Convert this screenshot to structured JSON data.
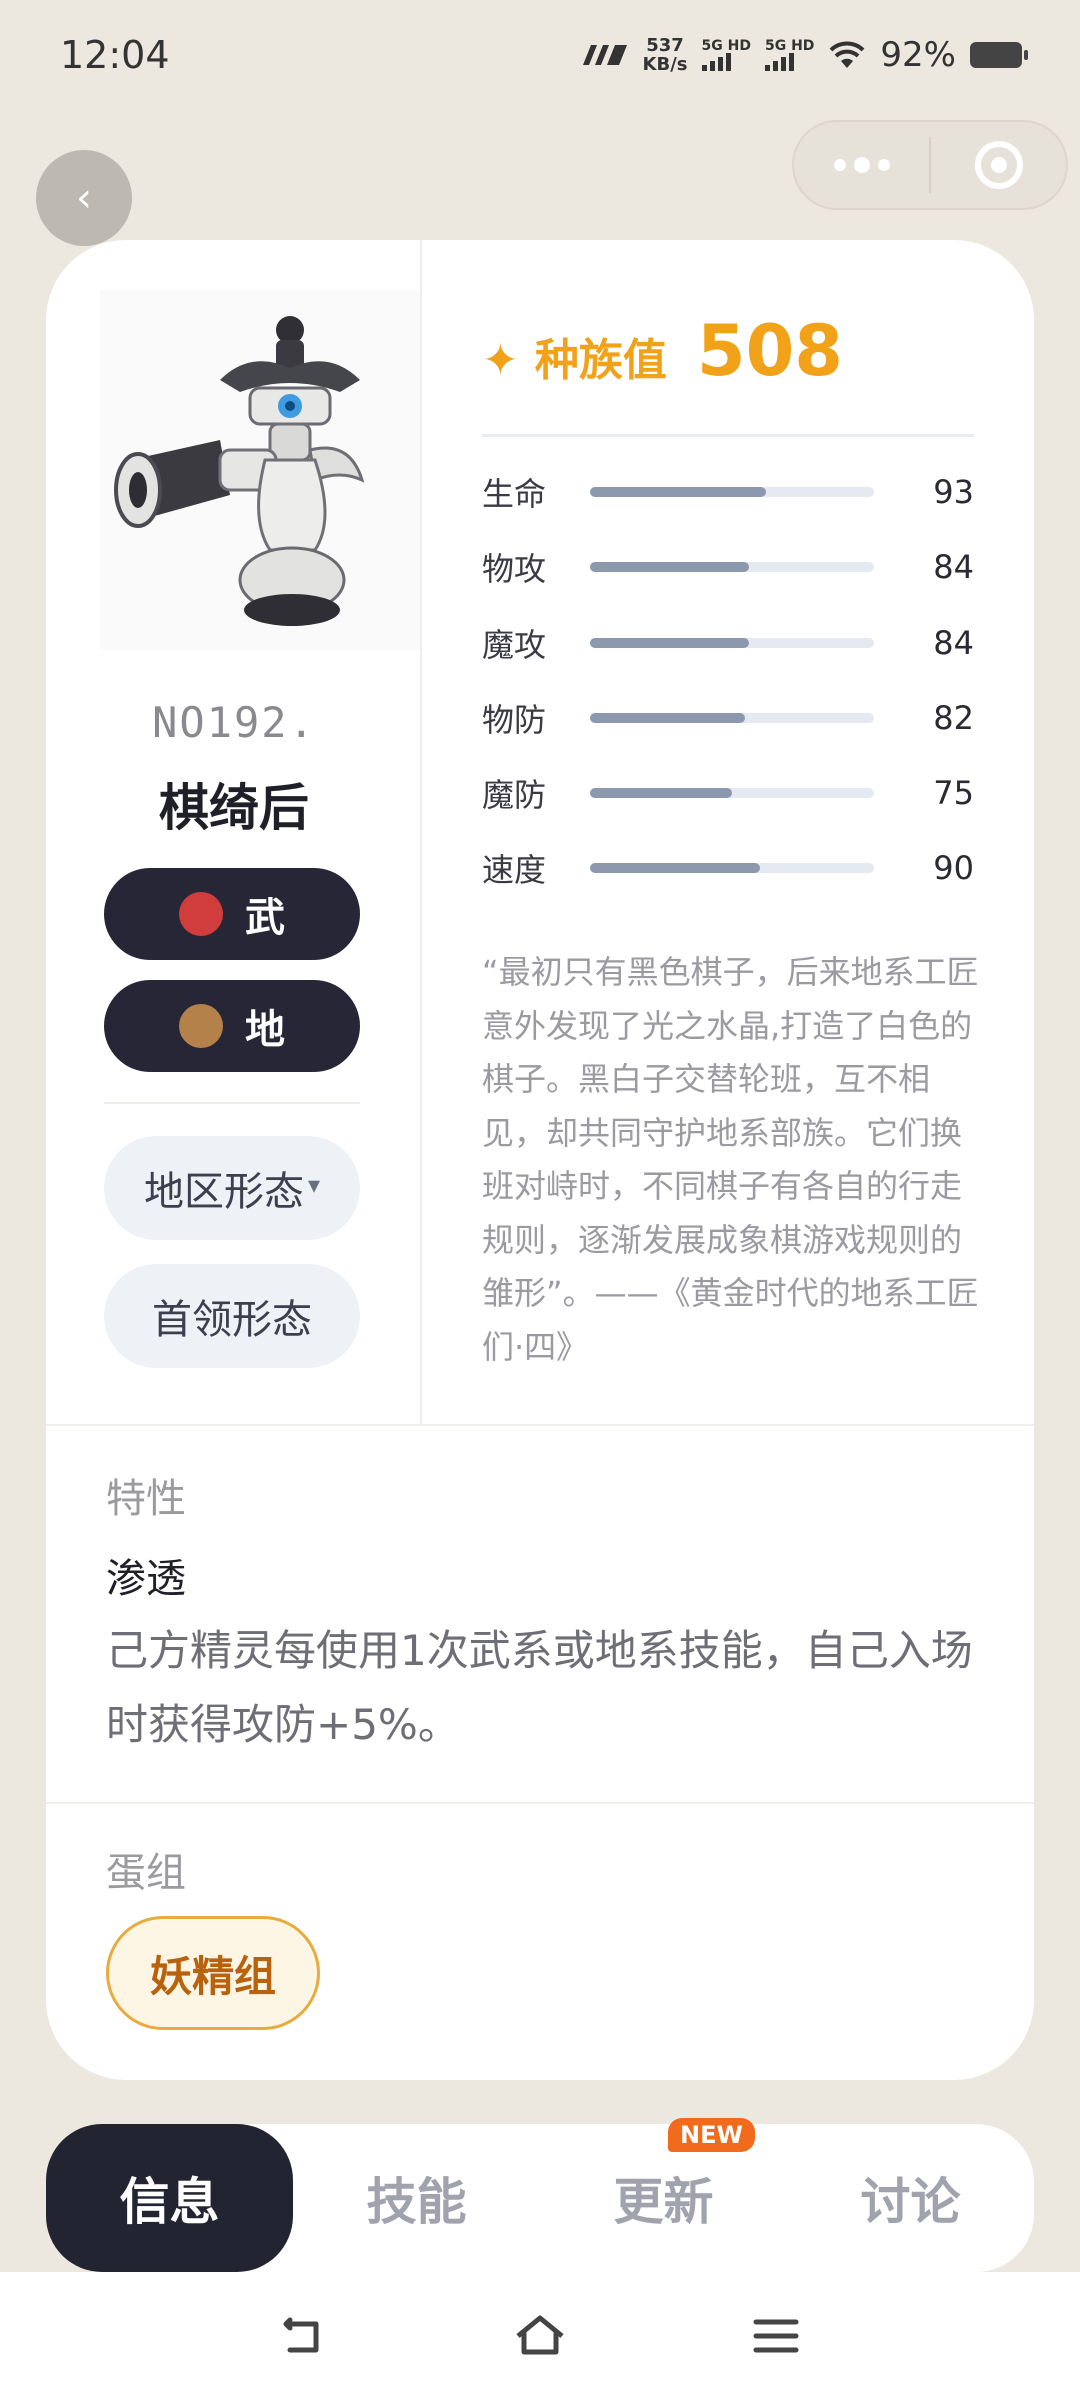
{
  "status_bar": {
    "time": "12:04",
    "net_speed_value": "537",
    "net_speed_unit": "KB/s",
    "sim1_label": "5G HD",
    "sim2_label": "5G HD",
    "battery_percent": "92%"
  },
  "header": {
    "back_icon": "chevron-left-icon",
    "menu_icon": "more-dots-icon",
    "close_icon": "target-icon"
  },
  "pokemon": {
    "number": "NO192.",
    "name": "棋绮后",
    "types": [
      {
        "label": "武",
        "color": "#D13C3C"
      },
      {
        "label": "地",
        "color": "#B5814A"
      }
    ],
    "forms": [
      "地区形态",
      "首领形态"
    ],
    "form_dropdown_caret": "▾"
  },
  "base_stats": {
    "label": "种族值",
    "total": "508",
    "star": "✦",
    "max_scale": 150,
    "stats": [
      {
        "name": "生命",
        "value": 93
      },
      {
        "name": "物攻",
        "value": 84
      },
      {
        "name": "魔攻",
        "value": 84
      },
      {
        "name": "物防",
        "value": 82
      },
      {
        "name": "魔防",
        "value": 75
      },
      {
        "name": "速度",
        "value": 90
      }
    ]
  },
  "description": "“最初只有黑色棋子，后来地系工匠意外发现了光之水晶,打造了白色的棋子。黑白子交替轮班，互不相见，却共同守护地系部族。它们换班对峙时，不同棋子有各自的行走规则，逐渐发展成象棋游戏规则的雏形”。——《黄金时代的地系工匠们·四》",
  "ability": {
    "section_title": "特性",
    "name": "渗透",
    "desc": "己方精灵每使用1次武系或地系技能，自己入场时获得攻防+5%。"
  },
  "egg_group": {
    "section_title": "蛋组",
    "value": "妖精组"
  },
  "tabs": [
    {
      "label": "信息",
      "active": true
    },
    {
      "label": "技能",
      "active": false
    },
    {
      "label": "更新",
      "active": false,
      "badge": "NEW"
    },
    {
      "label": "讨论",
      "active": false
    }
  ],
  "nav_bar": {
    "back": "back-arrow-icon",
    "home": "home-icon",
    "menu": "menu-icon"
  }
}
